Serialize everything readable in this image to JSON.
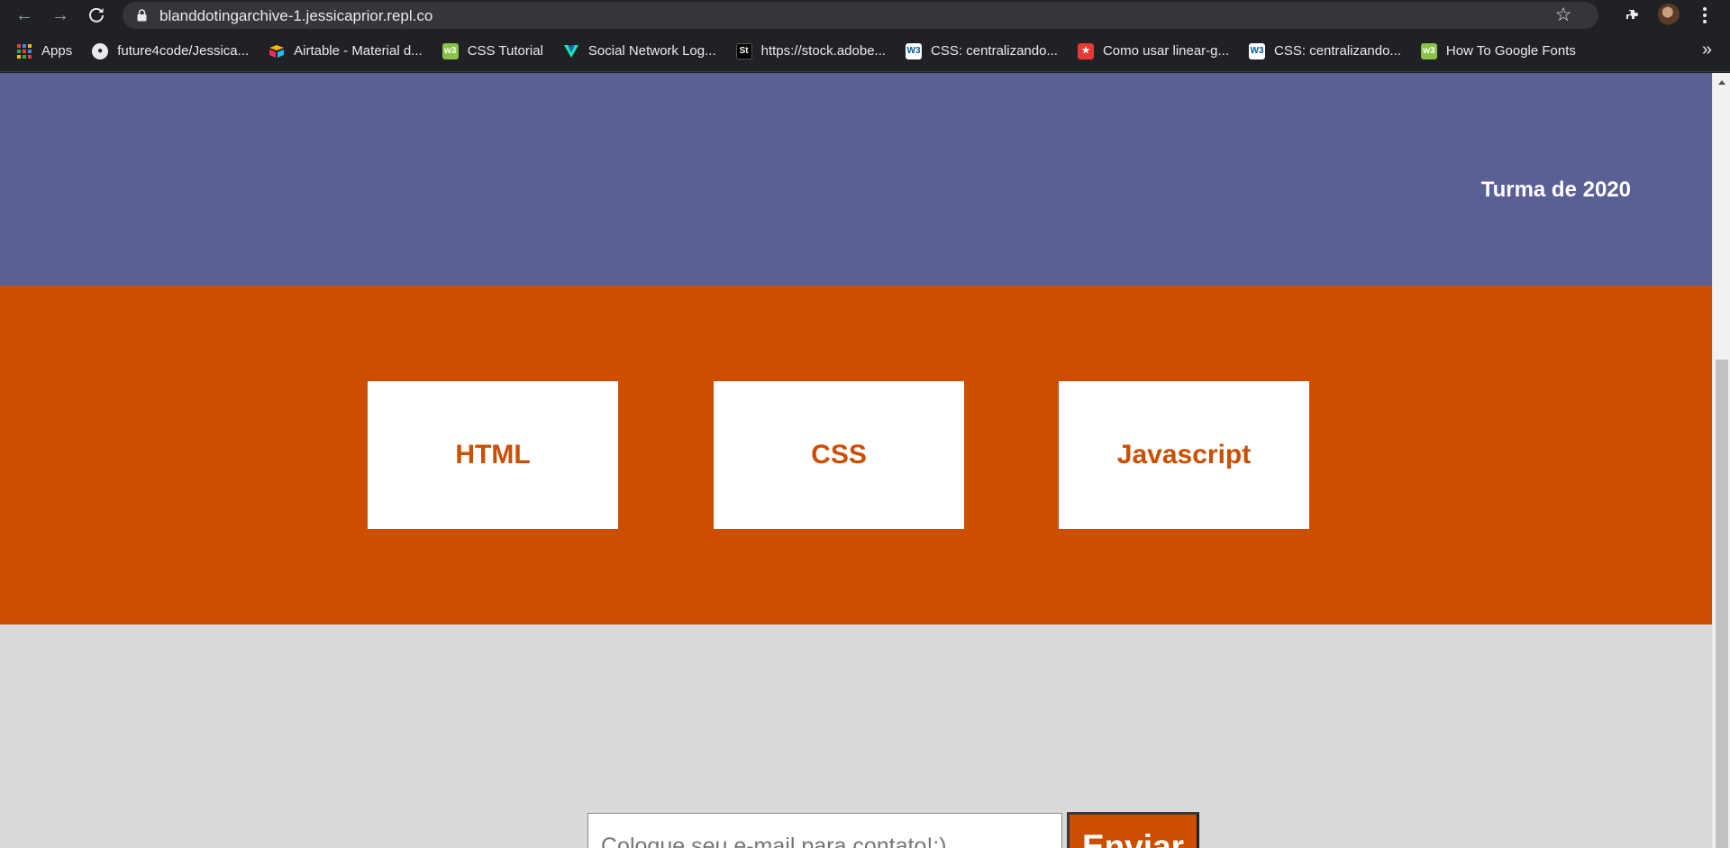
{
  "browser": {
    "url": "blanddotingarchive-1.jessicaprior.repl.co",
    "bookmarks": [
      {
        "label": "Apps",
        "icon": "apps-grid-icon"
      },
      {
        "label": "future4code/Jessica...",
        "icon": "github-icon"
      },
      {
        "label": "Airtable - Material d...",
        "icon": "airtable-icon"
      },
      {
        "label": "CSS Tutorial",
        "icon": "w3schools-icon"
      },
      {
        "label": "Social Network Log...",
        "icon": "vuetify-icon"
      },
      {
        "label": "https://stock.adobe...",
        "icon": "adobe-stock-icon"
      },
      {
        "label": "CSS: centralizando...",
        "icon": "w3c-icon"
      },
      {
        "label": "Como usar linear-g...",
        "icon": "red-star-icon"
      },
      {
        "label": "CSS: centralizando...",
        "icon": "w3c-icon"
      },
      {
        "label": "How To Google Fonts",
        "icon": "w3schools-icon"
      }
    ],
    "more_bookmarks": "»"
  },
  "page": {
    "hero": {
      "text": "Turma de 2020"
    },
    "skills": [
      {
        "label": "HTML"
      },
      {
        "label": "CSS"
      },
      {
        "label": "Javascript"
      }
    ],
    "contact": {
      "email_placeholder": "Coloque seu e-mail para contato!:)",
      "email_value": "",
      "send_label": "Enviar"
    }
  },
  "colors": {
    "hero_bg": "#5a5f96",
    "accent_orange": "#cc4e00",
    "contact_bg": "#d9d9d9"
  }
}
